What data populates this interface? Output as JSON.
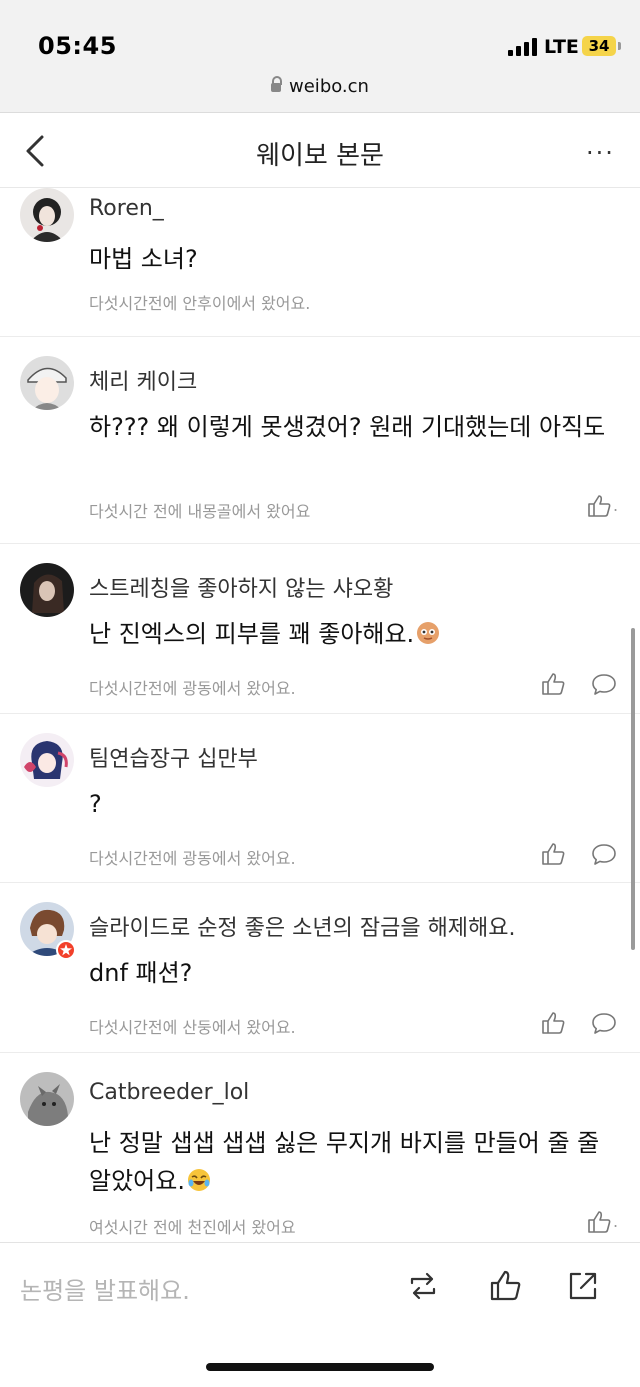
{
  "status_bar": {
    "time": "05:45",
    "network": "LTE",
    "battery": "34"
  },
  "browser": {
    "url": "weibo.cn"
  },
  "navbar": {
    "title": "웨이보 본문",
    "more": "···"
  },
  "comments": [
    {
      "username": "Roren_",
      "text": "마법 소녀?",
      "meta": "다섯시간전에 안후이에서 왔어요.",
      "actions": []
    },
    {
      "username": "체리 케이크",
      "text": "하??? 왜 이렇게 못생겼어? 원래 기대했는데 아직도",
      "meta": "다섯시간 전에 내몽골에서 왔어요",
      "actions": [
        "like"
      ],
      "suffix": "."
    },
    {
      "username": "스트레칭을 좋아하지 않는 샤오황",
      "text": "난 진엑스의 피부를 꽤 좋아해요.",
      "emoji": "sticker-emoji",
      "meta": "다섯시간전에 광동에서 왔어요.",
      "actions": [
        "like",
        "comment"
      ]
    },
    {
      "username": "팀연습장구 십만부",
      "text": "?",
      "meta": "다섯시간전에 광동에서 왔어요.",
      "actions": [
        "like",
        "comment"
      ]
    },
    {
      "username": "슬라이드로 순정 좋은 소년의 잠금을 해제해요.",
      "text": "dnf 패션?",
      "meta": "다섯시간전에 산둥에서 왔어요.",
      "actions": [
        "like",
        "comment"
      ]
    },
    {
      "username": "Catbreeder_lol",
      "text": "난 정말 샙샙 샙샙 싫은 무지개 바지를 만들어 줄 줄 알았어요.",
      "emoji": "laughing-crying-emoji",
      "meta": "여섯시간 전에 천진에서 왔어요",
      "actions": [
        "like"
      ],
      "suffix": "."
    }
  ],
  "bottom_bar": {
    "placeholder": "논평을 발표해요."
  },
  "colors": {
    "background": "#ffffff",
    "chrome": "#f2f2f2",
    "meta_text": "#999999",
    "battery": "#f5d44a"
  }
}
